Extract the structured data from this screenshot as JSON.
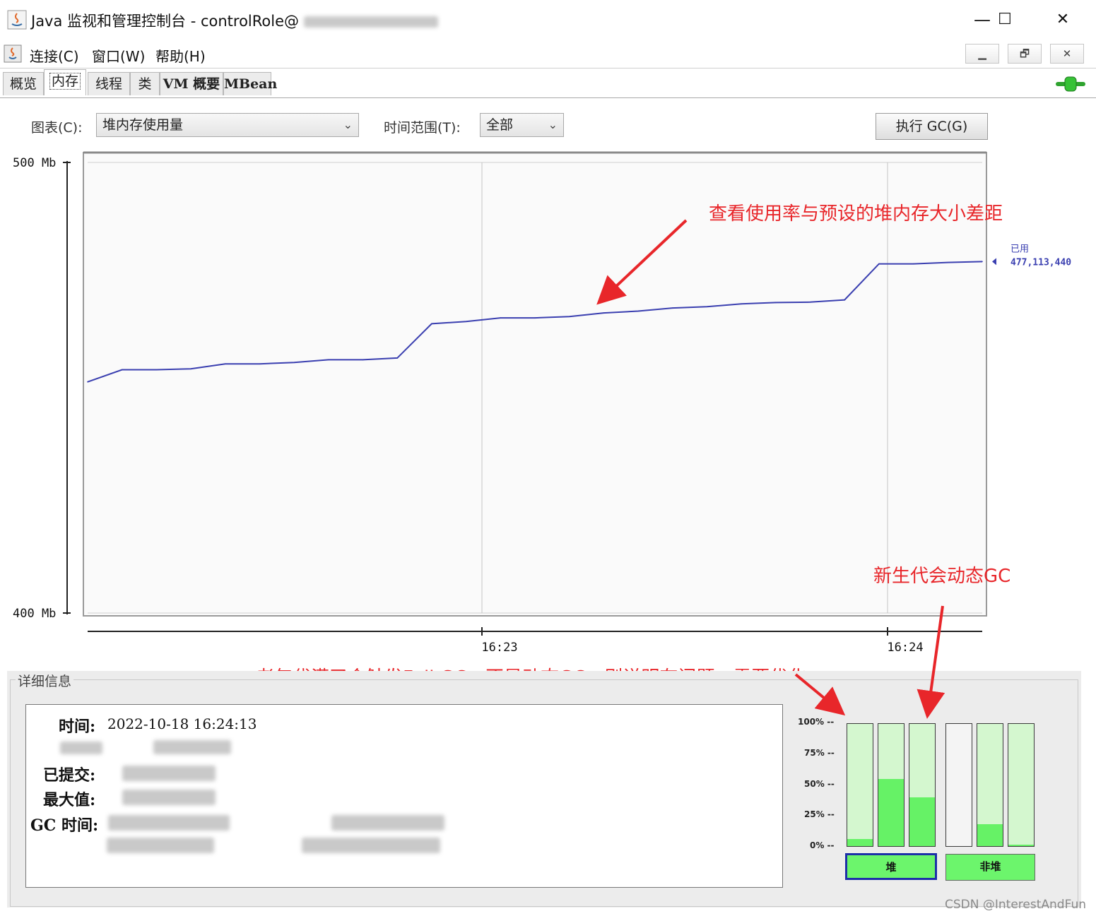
{
  "window": {
    "title": "Java 监视和管理控制台 - controlRole@",
    "controls": {
      "minimize": "—",
      "maximize": "☐",
      "close": "✕"
    }
  },
  "menu": {
    "items": [
      "连接(C)",
      "窗口(W)",
      "帮助(H)"
    ],
    "mdi": {
      "minimize": "▁",
      "restore": "🗗",
      "close": "✕"
    }
  },
  "tabs": [
    "概览",
    "内存",
    "线程",
    "类",
    "VM 概要",
    "MBean"
  ],
  "active_tab": "内存",
  "toolbar": {
    "chart_label": "图表(C):",
    "chart_value": "堆内存使用量",
    "range_label": "时间范围(T):",
    "range_value": "全部",
    "gc_button": "执行 GC(G)"
  },
  "chart_data": {
    "type": "line",
    "ylabel_top": "500 Mb",
    "ylabel_bottom": "400 Mb",
    "ylim": [
      400,
      500
    ],
    "x_ticks": [
      "16:23",
      "16:24"
    ],
    "series": [
      {
        "name": "已用",
        "color": "#3a3fb0",
        "current_value": "477,113,440",
        "values": [
          451.3,
          454.0,
          454.0,
          454.2,
          455.3,
          455.3,
          455.6,
          456.2,
          456.2,
          456.6,
          464.2,
          464.7,
          465.5,
          465.5,
          465.8,
          466.6,
          467.0,
          467.7,
          468.0,
          468.6,
          468.9,
          469.0,
          469.5,
          477.5,
          477.5,
          477.8,
          478.0
        ]
      }
    ],
    "grid": true
  },
  "annotations": {
    "arrow1_text": "查看使用率与预设的堆内存大小差距",
    "arrow2_text": "新生代会动态GC",
    "arrow3_text": "老年代满了会触发Full GC，不是动态GC，则说明有问题，需要优化"
  },
  "details": {
    "legend": "详细信息",
    "time_label": "时间:",
    "time_value": "2022-10-18 16:24:13",
    "committed_label": "已提交:",
    "max_label": "最大值:",
    "gc_label": "GC 时间:"
  },
  "memory_bars": {
    "pct_labels": [
      "100%",
      "75%",
      "50%",
      "25%",
      "0%"
    ],
    "heap": [
      0.06,
      0.55,
      0.4
    ],
    "nonheap": [
      0.0,
      0.18,
      0.01
    ],
    "heap_button": "堆",
    "nonheap_button": "非堆",
    "fill_color": "#66f266",
    "empty_color": "#d4f7cf"
  },
  "watermark": "CSDN @InterestAndFun"
}
